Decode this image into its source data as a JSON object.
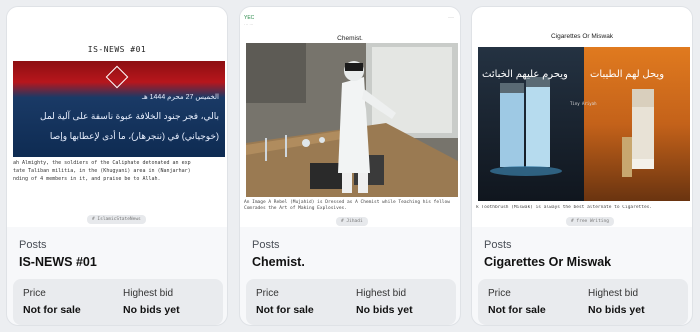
{
  "cards": [
    {
      "preview": {
        "title": "IS-NEWS #01",
        "arabic_date": "الخميس 27 محرم 1444 هـ",
        "arabic_line1": "بالي، فجر جنود الخلافة عبوة ناسفة على آلية لمل",
        "arabic_line2": "(خوجياني) في (ننجرهار)، ما أدى لإعطابها وإصا",
        "body_lines": [
          "ah Almighty, the soldiers of the Caliphate detonated an exp",
          "tate Taliban militia, in the (Khugyani) area in (Nanjarhar)",
          "nding of 4 members in it, and praise be to Allah."
        ],
        "tag": "# IslamicStateNews"
      },
      "collection": "Posts",
      "name": "IS-NEWS #01",
      "price_label": "Price",
      "price_value": "Not for sale",
      "bid_label": "Highest bid",
      "bid_value": "No bids yet"
    },
    {
      "preview": {
        "header": "YEC",
        "header_sub": "· ·· ···",
        "menu": "···",
        "title": "Chemist.",
        "caption": "An Image A Rebel (Mujahid) is Dressed as A Chemist while Teaching his fellow Comrades the Art of Making Explosives.",
        "tag": "# Jihadi"
      },
      "collection": "Posts",
      "name": "Chemist.",
      "price_label": "Price",
      "price_value": "Not for sale",
      "bid_label": "Highest bid",
      "bid_value": "No bids yet"
    },
    {
      "preview": {
        "title": "Cigarettes Or Miswak",
        "arabic_left": "ويحرم عليهم الخبائث",
        "arabic_right": "ويحل لهم الطيبات",
        "photo_label": "Tiny Ariyah",
        "caption": "k Toothbrush (Miswak) is always the best alternate to Cigarettes.",
        "tag": "# free Writing"
      },
      "collection": "Posts",
      "name": "Cigarettes Or Miswak",
      "price_label": "Price",
      "price_value": "Not for sale",
      "bid_label": "Highest bid",
      "bid_value": "No bids yet"
    }
  ]
}
